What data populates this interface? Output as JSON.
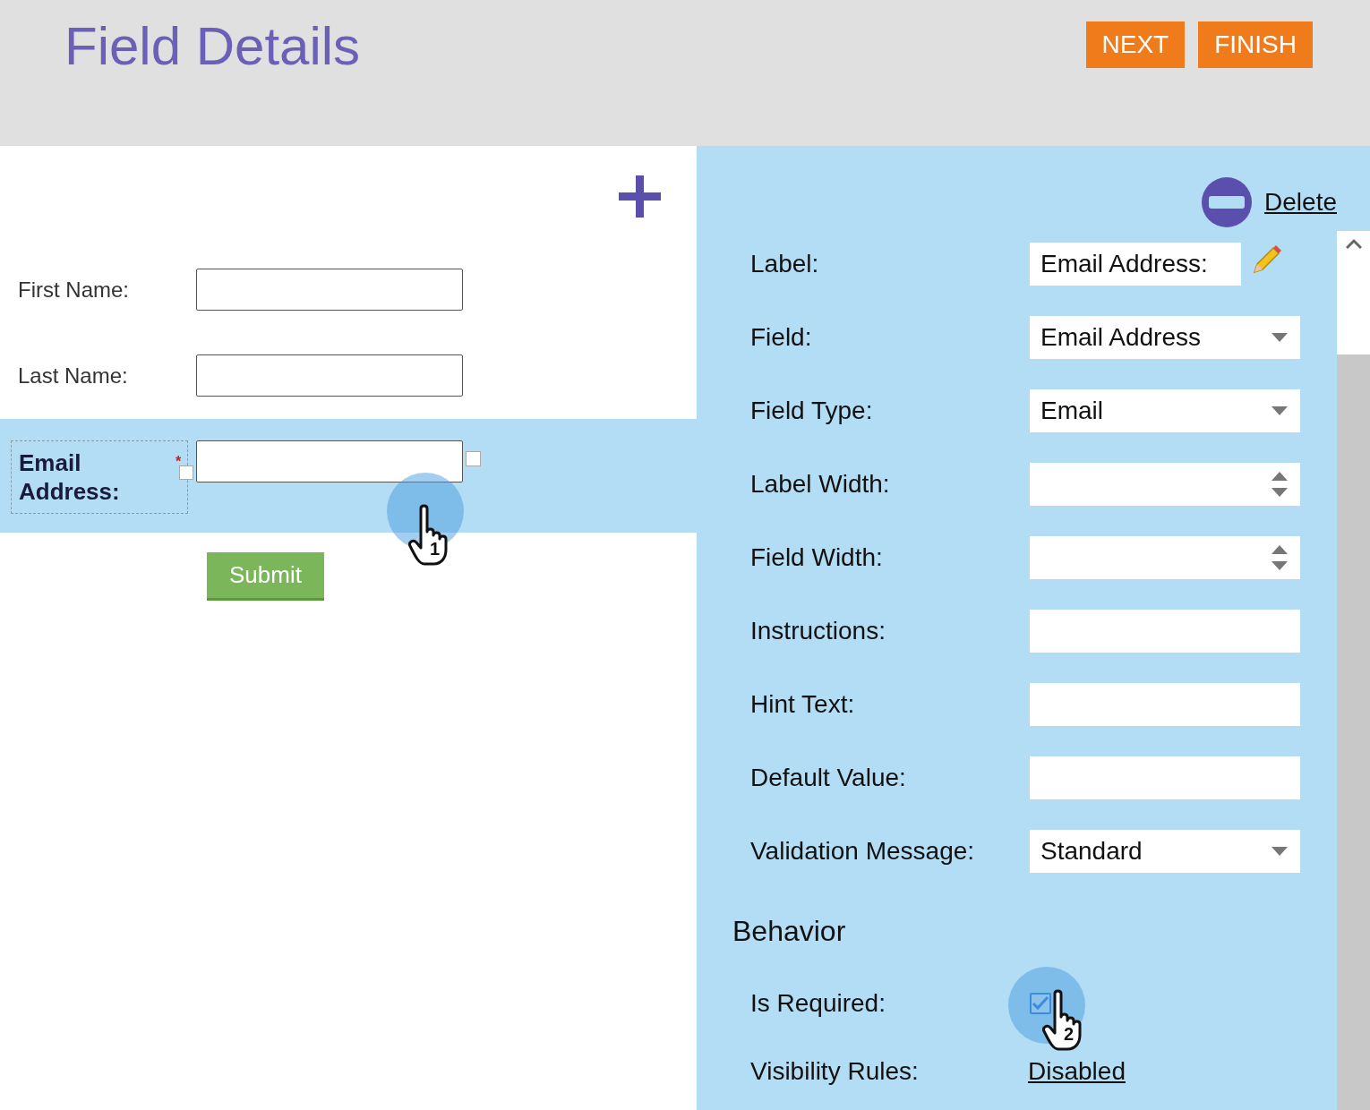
{
  "header": {
    "title": "Field Details",
    "buttons": [
      {
        "label": "NEXT"
      },
      {
        "label": "FINISH"
      }
    ]
  },
  "form_preview": {
    "fields": [
      {
        "label": "First Name:",
        "selected": false
      },
      {
        "label": "Last Name:",
        "selected": false
      },
      {
        "label": "Email Address:",
        "required_mark": "*",
        "selected": true
      }
    ],
    "submit": "Submit"
  },
  "properties": {
    "delete": "Delete",
    "rows": [
      {
        "label": "Label:",
        "kind": "editable",
        "value": "Email Address:"
      },
      {
        "label": "Field:",
        "kind": "select",
        "value": "Email Address"
      },
      {
        "label": "Field Type:",
        "kind": "select",
        "value": "Email"
      },
      {
        "label": "Label Width:",
        "kind": "spinner"
      },
      {
        "label": "Field Width:",
        "kind": "spinner"
      },
      {
        "label": "Instructions:",
        "kind": "text"
      },
      {
        "label": "Hint Text:",
        "kind": "text"
      },
      {
        "label": "Default Value:",
        "kind": "text"
      },
      {
        "label": "Validation Message:",
        "kind": "select",
        "value": "Standard"
      }
    ],
    "behavior": {
      "title": "Behavior",
      "is_required": {
        "label": "Is Required:",
        "checked": true
      },
      "visibility_rules": {
        "label": "Visibility Rules:",
        "link": "Disabled"
      }
    }
  },
  "cursors": [
    {
      "label": "1"
    },
    {
      "label": "2"
    }
  ]
}
